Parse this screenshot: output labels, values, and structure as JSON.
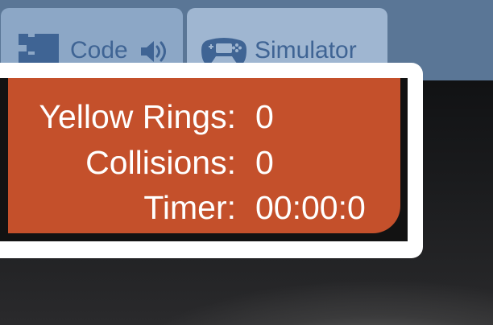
{
  "tabs": [
    {
      "label": "Code",
      "icon": "blocks-icon",
      "secondary_icon": "speaker-icon"
    },
    {
      "label": "Simulator",
      "icon": "gamepad-icon"
    }
  ],
  "stats": [
    {
      "label": "Yellow Rings:",
      "value": "0"
    },
    {
      "label": "Collisions:",
      "value": "0"
    },
    {
      "label": "Timer:",
      "value": "00:00:0"
    }
  ],
  "colors": {
    "topbar": "#5a7696",
    "tab": "#8ca7c6",
    "tab_text": "#3f6494",
    "panel": "#c4502b",
    "panel_text": "#ffffff"
  }
}
